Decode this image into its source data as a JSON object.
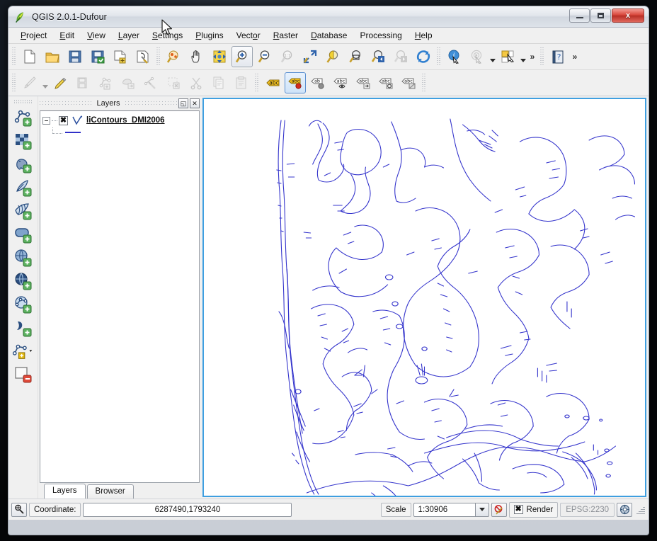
{
  "window": {
    "title": "QGIS 2.0.1-Dufour",
    "app_icon": "qgis-leaf-icon",
    "minimize_label": "",
    "maximize_label": "",
    "close_label": "x"
  },
  "menubar": {
    "items": [
      {
        "label": "Project",
        "mnemonic": "P"
      },
      {
        "label": "Edit",
        "mnemonic": "E"
      },
      {
        "label": "View",
        "mnemonic": "V"
      },
      {
        "label": "Layer",
        "mnemonic": "L"
      },
      {
        "label": "Settings",
        "mnemonic": "S"
      },
      {
        "label": "Plugins",
        "mnemonic": "P"
      },
      {
        "label": "Vector",
        "mnemonic": "o"
      },
      {
        "label": "Raster",
        "mnemonic": "R"
      },
      {
        "label": "Database",
        "mnemonic": "D"
      },
      {
        "label": "Processing",
        "mnemonic": ""
      },
      {
        "label": "Help",
        "mnemonic": "H"
      }
    ]
  },
  "toolbar_main": {
    "items": [
      {
        "name": "new-project-icon",
        "tooltip": "New Project"
      },
      {
        "name": "open-project-icon",
        "tooltip": "Open Project"
      },
      {
        "name": "save-project-icon",
        "tooltip": "Save Project"
      },
      {
        "name": "save-project-as-icon",
        "tooltip": "Save Project As"
      },
      {
        "name": "new-print-composer-icon",
        "tooltip": "New Print Composer"
      },
      {
        "name": "composer-manager-icon",
        "tooltip": "Composer Manager"
      },
      {
        "name": "pan-to-selection-icon",
        "tooltip": "Pan Map to Selection"
      },
      {
        "name": "pan-map-icon",
        "tooltip": "Pan Map"
      },
      {
        "name": "zoom-full-extent-icon",
        "tooltip": "Zoom Full"
      },
      {
        "name": "zoom-in-icon",
        "tooltip": "Zoom In",
        "state": "active"
      },
      {
        "name": "zoom-out-icon",
        "tooltip": "Zoom Out"
      },
      {
        "name": "zoom-native-icon",
        "tooltip": "Zoom to Native Resolution",
        "state": "disabled"
      },
      {
        "name": "zoom-full-icon",
        "tooltip": "Zoom Full"
      },
      {
        "name": "zoom-to-selection-icon",
        "tooltip": "Zoom to Selection"
      },
      {
        "name": "zoom-to-layer-icon",
        "tooltip": "Zoom to Layer"
      },
      {
        "name": "zoom-last-icon",
        "tooltip": "Zoom Last"
      },
      {
        "name": "zoom-next-icon",
        "tooltip": "Zoom Next",
        "state": "disabled"
      },
      {
        "name": "refresh-icon",
        "tooltip": "Refresh"
      },
      {
        "name": "identify-features-icon",
        "tooltip": "Identify Features"
      },
      {
        "name": "run-feature-action-icon",
        "tooltip": "Run Feature Action",
        "state": "disabled"
      },
      {
        "name": "select-features-icon",
        "tooltip": "Select Features"
      },
      {
        "name": "help-contents-icon",
        "tooltip": "Help Contents"
      }
    ],
    "overflow_label": "»"
  },
  "toolbar_digitizing": {
    "items": [
      {
        "name": "current-edits-icon",
        "tooltip": "Current Edits",
        "state": "disabled"
      },
      {
        "name": "toggle-editing-icon",
        "tooltip": "Toggle Editing"
      },
      {
        "name": "save-layer-edits-icon",
        "tooltip": "Save Layer Edits",
        "state": "disabled"
      },
      {
        "name": "add-feature-icon",
        "tooltip": "Add Feature",
        "state": "disabled"
      },
      {
        "name": "move-feature-icon",
        "tooltip": "Move Feature",
        "state": "disabled"
      },
      {
        "name": "node-tool-icon",
        "tooltip": "Node Tool",
        "state": "disabled"
      },
      {
        "name": "delete-selected-icon",
        "tooltip": "Delete Selected",
        "state": "disabled"
      },
      {
        "name": "cut-features-icon",
        "tooltip": "Cut Features",
        "state": "disabled"
      },
      {
        "name": "copy-features-icon",
        "tooltip": "Copy Features",
        "state": "disabled"
      },
      {
        "name": "paste-features-icon",
        "tooltip": "Paste Features",
        "state": "disabled"
      },
      {
        "name": "layer-labeling-icon",
        "tooltip": "Layer Labeling Options"
      },
      {
        "name": "pin-labels-icon",
        "tooltip": "Pin/Unpin Labels",
        "state": "selected"
      },
      {
        "name": "show-hide-labels-icon",
        "tooltip": "Show/Hide Labels"
      },
      {
        "name": "highlight-pinned-labels-icon",
        "tooltip": "Highlight Pinned Labels"
      },
      {
        "name": "move-label-icon",
        "tooltip": "Move Label"
      },
      {
        "name": "rotate-label-icon",
        "tooltip": "Rotate Label"
      },
      {
        "name": "change-label-icon",
        "tooltip": "Change Label"
      }
    ]
  },
  "left_rail": {
    "items": [
      {
        "name": "add-vector-layer-icon",
        "tooltip": "Add Vector Layer"
      },
      {
        "name": "add-raster-layer-icon",
        "tooltip": "Add Raster Layer"
      },
      {
        "name": "add-postgis-layer-icon",
        "tooltip": "Add PostGIS Layer"
      },
      {
        "name": "add-spatialite-layer-icon",
        "tooltip": "Add SpatiaLite Layer"
      },
      {
        "name": "add-mssql-layer-icon",
        "tooltip": "Add MSSQL Spatial Layer"
      },
      {
        "name": "add-oracle-layer-icon",
        "tooltip": "Add Oracle Spatial Layer"
      },
      {
        "name": "add-wms-layer-icon",
        "tooltip": "Add WMS/WMTS Layer"
      },
      {
        "name": "add-wcs-layer-icon",
        "tooltip": "Add WCS Layer"
      },
      {
        "name": "add-wfs-layer-icon",
        "tooltip": "Add WFS Layer"
      },
      {
        "name": "add-delimited-text-layer-icon",
        "tooltip": "Add Delimited Text Layer"
      },
      {
        "name": "new-shapefile-layer-icon",
        "tooltip": "New Shapefile Layer"
      },
      {
        "name": "remove-layer-icon",
        "tooltip": "Remove Layer"
      }
    ]
  },
  "layers_panel": {
    "title": "Layers",
    "float_button": "◱",
    "close_button": "✕",
    "tree": {
      "checkbox_mark": "✖",
      "layer_name": "liContours_DMI2006",
      "symbol_color": "#3030c8"
    },
    "tabs": [
      {
        "label": "Layers",
        "active": true
      },
      {
        "label": "Browser",
        "active": false
      }
    ]
  },
  "map": {
    "layer_line_color": "#3434cc",
    "background_color": "#ffffff",
    "border_color": "#3f9fe0"
  },
  "statusbar": {
    "lock_icon": "messages-icon",
    "coordinate_label": "Coordinate:",
    "coordinate_value": "6287490,1793240",
    "scale_label": "Scale",
    "scale_value": "1:30906",
    "scale_dropdown_icon": "chevron-down-icon",
    "rotation_icon": "no-rotation-icon",
    "render_check_mark": "✖",
    "render_label": "Render",
    "crs_label": "EPSG:2230",
    "crs_icon": "crs-status-icon"
  }
}
